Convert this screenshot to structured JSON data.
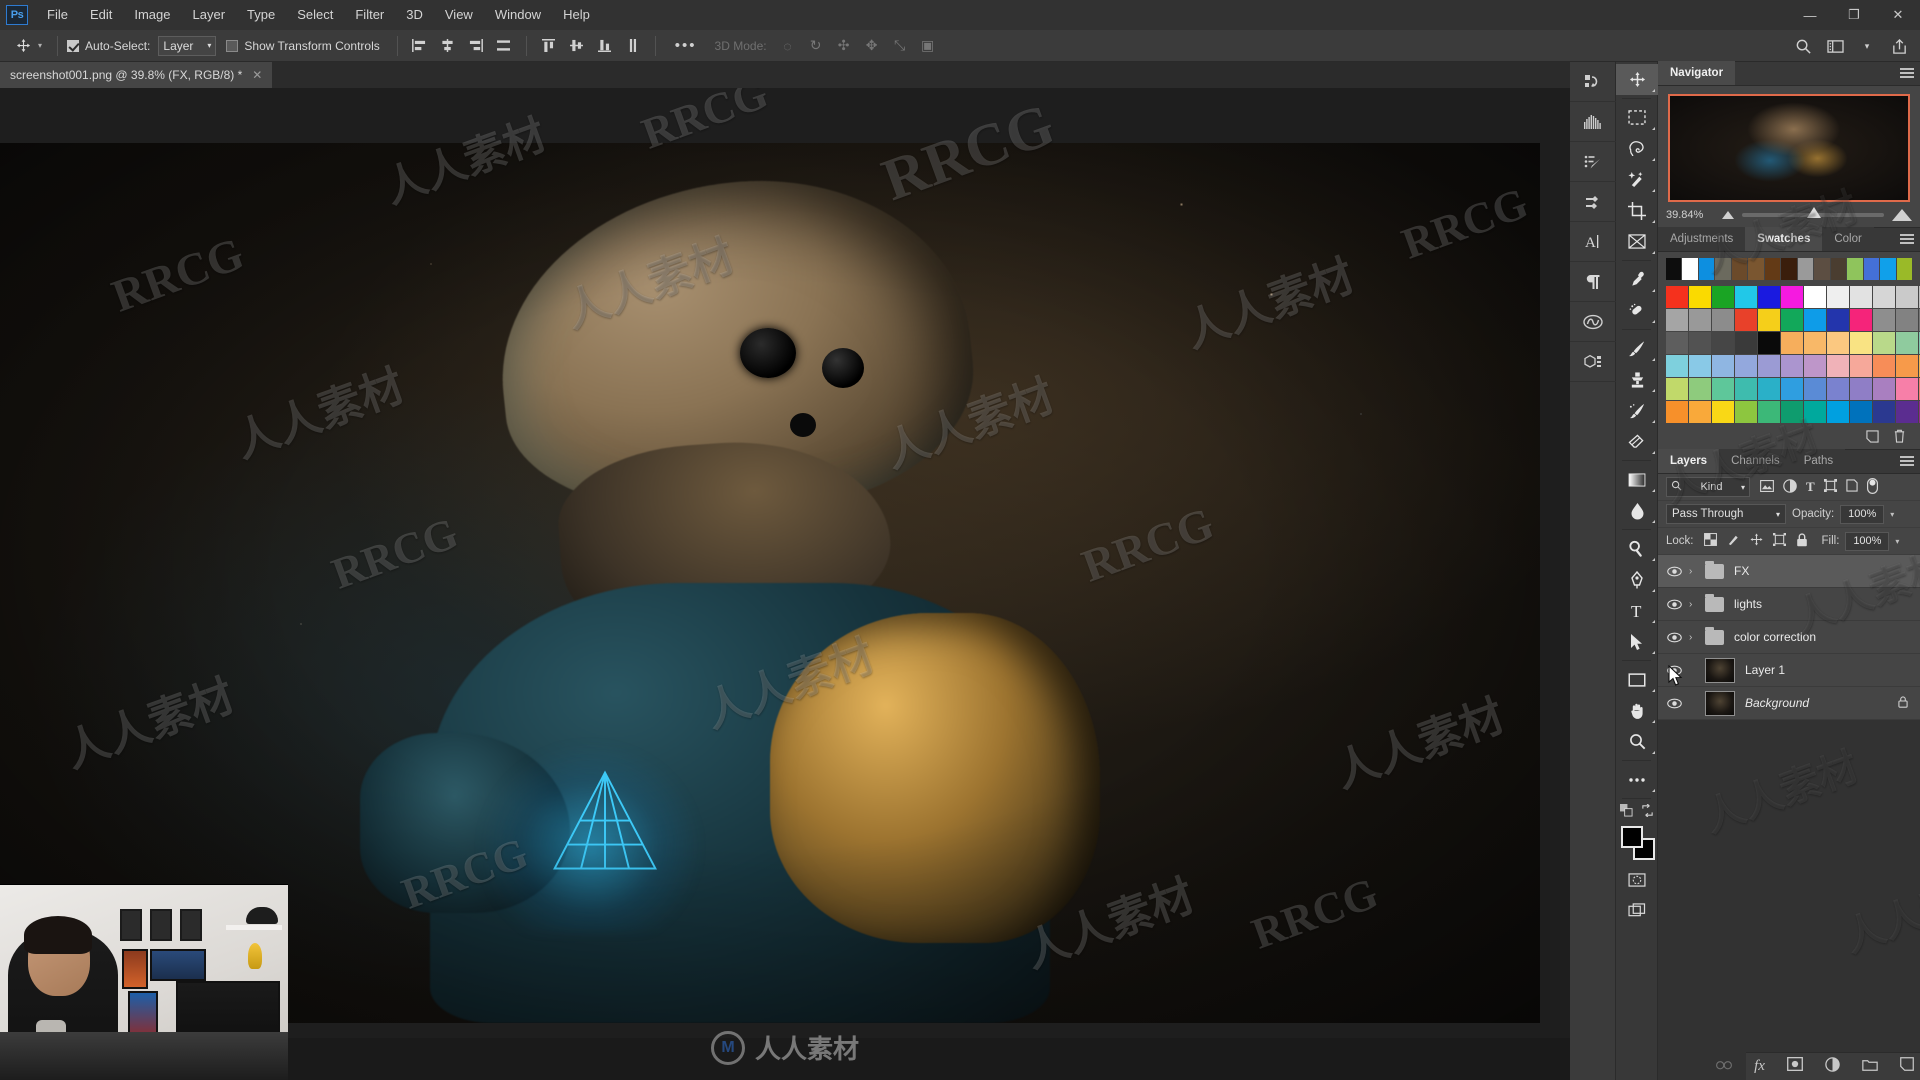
{
  "app": {
    "name": "Ps",
    "title": "Adobe Photoshop"
  },
  "menubar": {
    "items": [
      "File",
      "Edit",
      "Image",
      "Layer",
      "Type",
      "Select",
      "Filter",
      "3D",
      "View",
      "Window",
      "Help"
    ],
    "window_controls": {
      "minimize": "—",
      "maximize": "❐",
      "close": "✕"
    }
  },
  "options_bar": {
    "tool_icon": "move-tool-icon",
    "auto_select_label": "Auto-Select:",
    "auto_select_checked": true,
    "auto_select_value": "Layer",
    "show_transform_label": "Show Transform Controls",
    "show_transform_checked": false,
    "align_icons": [
      "align-left-edges",
      "align-horizontal-centers",
      "align-right-edges",
      "distribute-horizontal",
      "align-top-edges",
      "align-vertical-centers",
      "align-bottom-edges",
      "distribute-vertical"
    ],
    "more_label": "•••",
    "mode_label": "3D Mode:",
    "mode_icons": [
      "orbit-3d-icon",
      "roll-3d-icon",
      "pan-3d-icon",
      "slide-3d-icon",
      "scale-3d-icon",
      "camera-3d-icon"
    ],
    "right_icons": [
      "search-icon",
      "workspace-icon",
      "chevron-down-icon",
      "share-icon"
    ]
  },
  "document_tab": {
    "title": "screenshot001.png @ 39.8% (FX, RGB/8) *",
    "close": "✕"
  },
  "toolbar": {
    "tools": [
      {
        "name": "move-tool",
        "glyph": "✥",
        "active": true
      },
      {
        "name": "rectangular-marquee-tool",
        "glyph": "⬚",
        "active": false
      },
      {
        "name": "lasso-tool",
        "glyph": "☂",
        "active": false
      },
      {
        "name": "quick-selection-tool",
        "glyph": "✦",
        "active": false
      },
      {
        "name": "crop-tool",
        "glyph": "⌗",
        "active": false
      },
      {
        "name": "frame-tool",
        "glyph": "⌧",
        "active": false
      },
      {
        "name": "eyedropper-tool",
        "glyph": "✐",
        "active": false
      },
      {
        "name": "spot-healing-brush-tool",
        "glyph": "⊕",
        "active": false
      },
      {
        "name": "brush-tool",
        "glyph": "✎",
        "active": false
      },
      {
        "name": "clone-stamp-tool",
        "glyph": "⚒",
        "active": false
      },
      {
        "name": "history-brush-tool",
        "glyph": "✒",
        "active": false
      },
      {
        "name": "eraser-tool",
        "glyph": "▱",
        "active": false
      },
      {
        "name": "gradient-tool",
        "glyph": "▤",
        "active": false
      },
      {
        "name": "blur-tool",
        "glyph": "●",
        "active": false
      },
      {
        "name": "dodge-tool",
        "glyph": "⚲",
        "active": false
      },
      {
        "name": "pen-tool",
        "glyph": "✑",
        "active": false
      },
      {
        "name": "horizontal-type-tool",
        "glyph": "T",
        "active": false
      },
      {
        "name": "path-selection-tool",
        "glyph": "➤",
        "active": false
      },
      {
        "name": "rectangle-tool",
        "glyph": "▭",
        "active": false
      },
      {
        "name": "hand-tool",
        "glyph": "✋",
        "active": false
      },
      {
        "name": "zoom-tool",
        "glyph": "⌕",
        "active": false
      },
      {
        "name": "edit-toolbar",
        "glyph": "•••",
        "active": false
      }
    ],
    "default_colors_icon": "default-colors-icon",
    "swap_colors_icon": "swap-colors-icon",
    "foreground_color": "#000000",
    "background_color": "#000000",
    "quick_mask_icon": "quick-mask-icon",
    "screen_mode_icon": "screen-mode-icon"
  },
  "rail_icons": [
    "history-panel-icon",
    "histogram-panel-icon",
    "actions-panel-icon",
    "brush-settings-icon",
    "character-panel-icon",
    "paragraph-panel-icon",
    "cc-libraries-icon",
    "3d-panel-icon"
  ],
  "navigator": {
    "tab": "Navigator",
    "zoom_value": "39.84%",
    "zoom_out_icon": "zoom-out-icon",
    "zoom_in_icon": "zoom-in-icon",
    "menu_icon": "panel-menu-icon"
  },
  "swatches": {
    "tabs": [
      {
        "label": "Adjustments",
        "active": false
      },
      {
        "label": "Swatches",
        "active": true
      },
      {
        "label": "Color",
        "active": false
      }
    ],
    "menu_icon": "panel-menu-icon",
    "recent": [
      "#0d0d0d",
      "#ffffff",
      "#0d8fe0",
      "#6b6a5e",
      "#6b4a2a",
      "#7a5630",
      "#633a16",
      "#3a1e0c",
      "#9a9a9a",
      "#5c4e42",
      "#4a3d30",
      "#8fc45c",
      "#4470d8",
      "#10a0ea",
      "#9aba28"
    ],
    "grid": [
      [
        "#f5311d",
        "#fada00",
        "#1aa424",
        "#21c8e8",
        "#1a1ae0",
        "#f51ae0",
        "#ffffff",
        "#efefef",
        "#e2e2e2",
        "#d6d6d6",
        "#cacaca",
        "#bdbdbd",
        "#b1b1b1"
      ],
      [
        "#a5a5a5",
        "#999999",
        "#8c8c8c",
        "#e8412a",
        "#f5cf1a",
        "#12a85a",
        "#0e9ce8",
        "#2335ac",
        "#f5247a",
        "#8e8e8e",
        "#828282",
        "#767676",
        "#6a6a6a"
      ],
      [
        "#5e5e5e",
        "#525252",
        "#464646",
        "#3a3a3a",
        "#0a0a0a",
        "#f6ae5c",
        "#f8b868",
        "#fbc880",
        "#f9e383",
        "#b9d98a",
        "#8fcb9e",
        "#7fc6ae",
        "#74c0bb"
      ],
      [
        "#7ed0dd",
        "#89c9e7",
        "#8fb6e2",
        "#93a8dd",
        "#9b9bd4",
        "#ab95cf",
        "#be96c9",
        "#f0b2b8",
        "#f6a89a",
        "#f78d58",
        "#f79a4a",
        "#f7b34f",
        "#f8e878"
      ],
      [
        "#c1d96a",
        "#8ecb7d",
        "#5ec79a",
        "#3ebcae",
        "#2ab0c8",
        "#2f9ee0",
        "#5a8bd6",
        "#7a82cf",
        "#8f7ec6",
        "#a97fc0",
        "#f77fa8",
        "#f77f73",
        "#f5432a"
      ],
      [
        "#f7902a",
        "#f9a93a",
        "#f9d816",
        "#8dc63f",
        "#3cb878",
        "#0f9c6e",
        "#00a99d",
        "#00a0e0",
        "#0072bc",
        "#2b3990",
        "#5b2d90",
        "#92278f",
        "#be3ba2"
      ]
    ],
    "new_swatch_icon": "new-swatch-icon",
    "delete_swatch_icon": "delete-swatch-icon"
  },
  "layers_panel": {
    "tabs": [
      {
        "label": "Layers",
        "active": true
      },
      {
        "label": "Channels",
        "active": false
      },
      {
        "label": "Paths",
        "active": false
      }
    ],
    "menu_icon": "panel-menu-icon",
    "filter": {
      "kind_label": "Kind",
      "search_icon": "search-icon",
      "chevron": "∨",
      "filter_icons": [
        "filter-pixel-icon",
        "filter-adjustment-icon",
        "filter-type-icon",
        "filter-shape-icon",
        "filter-smart-object-icon"
      ],
      "toggle_icon": "filter-toggle-icon"
    },
    "blend_mode": "Pass Through",
    "opacity_label": "Opacity:",
    "opacity_value": "100%",
    "lock_label": "Lock:",
    "lock_icons": [
      "lock-transparent-pixels-icon",
      "lock-image-pixels-icon",
      "lock-position-icon",
      "lock-artboard-icon",
      "lock-all-icon"
    ],
    "fill_label": "Fill:",
    "fill_value": "100%",
    "layers": [
      {
        "name": "FX",
        "type": "group",
        "visible": true,
        "selected": true,
        "expanded": false,
        "locked": false,
        "italic": false
      },
      {
        "name": "lights",
        "type": "group",
        "visible": true,
        "selected": false,
        "expanded": false,
        "locked": false,
        "italic": false
      },
      {
        "name": "color correction",
        "type": "group",
        "visible": true,
        "selected": false,
        "expanded": false,
        "locked": false,
        "italic": false
      },
      {
        "name": "Layer 1",
        "type": "pixel",
        "visible": true,
        "selected": false,
        "expanded": false,
        "locked": false,
        "italic": false
      },
      {
        "name": "Background",
        "type": "pixel",
        "visible": true,
        "selected": false,
        "expanded": false,
        "locked": true,
        "italic": true
      }
    ],
    "footer_icons": [
      "link-layers-icon",
      "layer-style-fx-icon",
      "add-layer-mask-icon",
      "new-adjustment-layer-icon",
      "new-group-icon",
      "new-layer-icon",
      "delete-layer-icon"
    ]
  },
  "canvas": {
    "document_name": "screenshot001.png",
    "zoom": "39.8%",
    "color_mode": "RGB/8",
    "artwork_description": "alien creature holding glowing blue pyramid"
  },
  "watermarks": {
    "latin": "RRCG",
    "cjk": "人人素材",
    "logo_letter": "M",
    "bottom_text": "人人素材"
  },
  "webcam": {
    "label": "webcam-overlay"
  }
}
